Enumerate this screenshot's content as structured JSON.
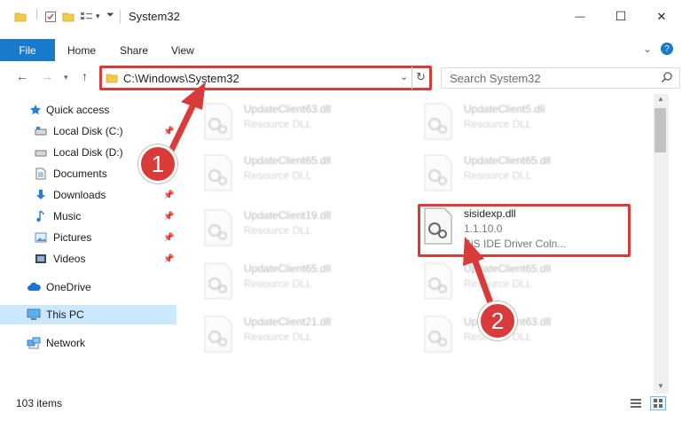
{
  "window": {
    "title": "System32",
    "controls": {
      "minimize": "—",
      "maximize": "☐",
      "close": "✕"
    }
  },
  "ribbon": {
    "tabs": [
      {
        "label": "File"
      },
      {
        "label": "Home"
      },
      {
        "label": "Share"
      },
      {
        "label": "View"
      }
    ]
  },
  "address_bar": {
    "path": "C:\\Windows\\System32"
  },
  "search": {
    "placeholder": "Search System32"
  },
  "nav_pane": {
    "items": [
      {
        "label": "Quick access",
        "icon": "star-icon"
      },
      {
        "label": "Local Disk (C:)",
        "icon": "drive-icon",
        "pinned": true
      },
      {
        "label": "Local Disk (D:)",
        "icon": "drive-icon"
      },
      {
        "label": "Documents",
        "icon": "documents-icon",
        "pinned": true
      },
      {
        "label": "Downloads",
        "icon": "downloads-icon",
        "pinned": true
      },
      {
        "label": "Music",
        "icon": "music-icon",
        "pinned": true
      },
      {
        "label": "Pictures",
        "icon": "pictures-icon",
        "pinned": true
      },
      {
        "label": "Videos",
        "icon": "videos-icon",
        "pinned": true
      },
      {
        "label": "OneDrive",
        "icon": "cloud-icon"
      },
      {
        "label": "This PC",
        "icon": "computer-icon",
        "selected": true
      },
      {
        "label": "Network",
        "icon": "network-icon"
      }
    ]
  },
  "files": [
    {
      "name": "UpdateClient63.dll",
      "line2": "Resource DLL",
      "line3": ""
    },
    {
      "name": "UpdateClient5.dll",
      "line2": "Resource DLL",
      "line3": ""
    },
    {
      "name": "UpdateClient65.dll",
      "line2": "Resource DLL",
      "line3": ""
    },
    {
      "name": "UpdateClient65.dll",
      "line2": "Resource DLL",
      "line3": ""
    },
    {
      "name": "UpdateClient19.dll",
      "line2": "Resource DLL",
      "line3": ""
    },
    {
      "name": "sisidexp.dll",
      "line2": "1.1.10.0",
      "line3": "SiS IDE Driver Coln..."
    },
    {
      "name": "UpdateClient65.dll",
      "line2": "Resource DLL",
      "line3": ""
    },
    {
      "name": "UpdateClient65.dll",
      "line2": "Resource DLL",
      "line3": ""
    },
    {
      "name": "UpdateClient21.dll",
      "line2": "Resource DLL",
      "line3": ""
    },
    {
      "name": "UpdateClient63.dll",
      "line2": "Resource DLL",
      "line3": ""
    }
  ],
  "status_bar": {
    "item_count": "103 items"
  },
  "callouts": [
    {
      "number": "1"
    },
    {
      "number": "2"
    }
  ],
  "colors": {
    "accent": "#1979ca",
    "highlight": "#d93a3a",
    "selected_nav": "#cce8ff"
  }
}
